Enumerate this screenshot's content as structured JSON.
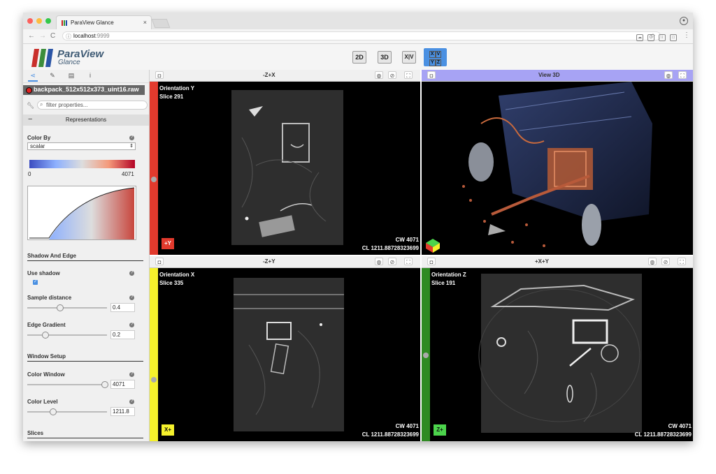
{
  "browser": {
    "tab_title": "ParaView Glance",
    "tab_close": "×",
    "url_host": "localhost",
    "url_port": ":9999",
    "nav": {
      "back": "←",
      "forward": "→",
      "reload": "C"
    }
  },
  "app": {
    "logo_title": "ParaView",
    "logo_subtitle": "Glance",
    "view_buttons": [
      {
        "label": "2D",
        "active": false
      },
      {
        "label": "3D",
        "active": false
      },
      {
        "label": "X|V",
        "active": false
      },
      {
        "label": "XV YZ",
        "active": true
      }
    ]
  },
  "sidebar": {
    "tabs": [
      "share-icon",
      "pencil-icon",
      "document-icon",
      "info-icon"
    ],
    "dataset_name": "backpack_512x512x373_uint16.raw",
    "filter_placeholder": "filter properties...",
    "representations_title": "Representations",
    "color_by_label": "Color By",
    "color_by_value": "scalar",
    "colormap_min": "0",
    "colormap_max": "4071",
    "shadow_edge_title": "Shadow And Edge",
    "use_shadow_label": "Use shadow",
    "sample_distance_label": "Sample distance",
    "sample_distance_value": "0.4",
    "sample_distance_fraction": 0.4,
    "edge_gradient_label": "Edge Gradient",
    "edge_gradient_value": "0.2",
    "edge_gradient_fraction": 0.2,
    "window_setup_title": "Window Setup",
    "color_window_label": "Color Window",
    "color_window_value": "4071",
    "color_window_fraction": 1.0,
    "color_level_label": "Color Level",
    "color_level_value": "1211.8",
    "color_level_fraction": 0.3,
    "slices_title": "Slices"
  },
  "views": {
    "top_left": {
      "title": "-Z+X",
      "orientation": "Orientation Y",
      "slice": "Slice 291",
      "cw": "CW 4071",
      "cl": "CL 1211.88728323699",
      "axis_label": "+Y",
      "stripe_color": "#e23a2d"
    },
    "top_right": {
      "title": "View 3D"
    },
    "bottom_left": {
      "title": "-Z+Y",
      "orientation": "Orientation X",
      "slice": "Slice 335",
      "cw": "CW 4071",
      "cl": "CL 1211.88728323699",
      "axis_label": "X+",
      "stripe_color": "#f5f12c"
    },
    "bottom_right": {
      "title": "+X+Y",
      "orientation": "Orientation Z",
      "slice": "Slice 191",
      "cw": "CW 4071",
      "cl": "CL 1211.88728323699",
      "axis_label": "Z+",
      "stripe_color": "#2f8a23"
    }
  },
  "colors": {
    "accent": "#4a90e2",
    "active_view_bar": "#a7a3f4"
  }
}
